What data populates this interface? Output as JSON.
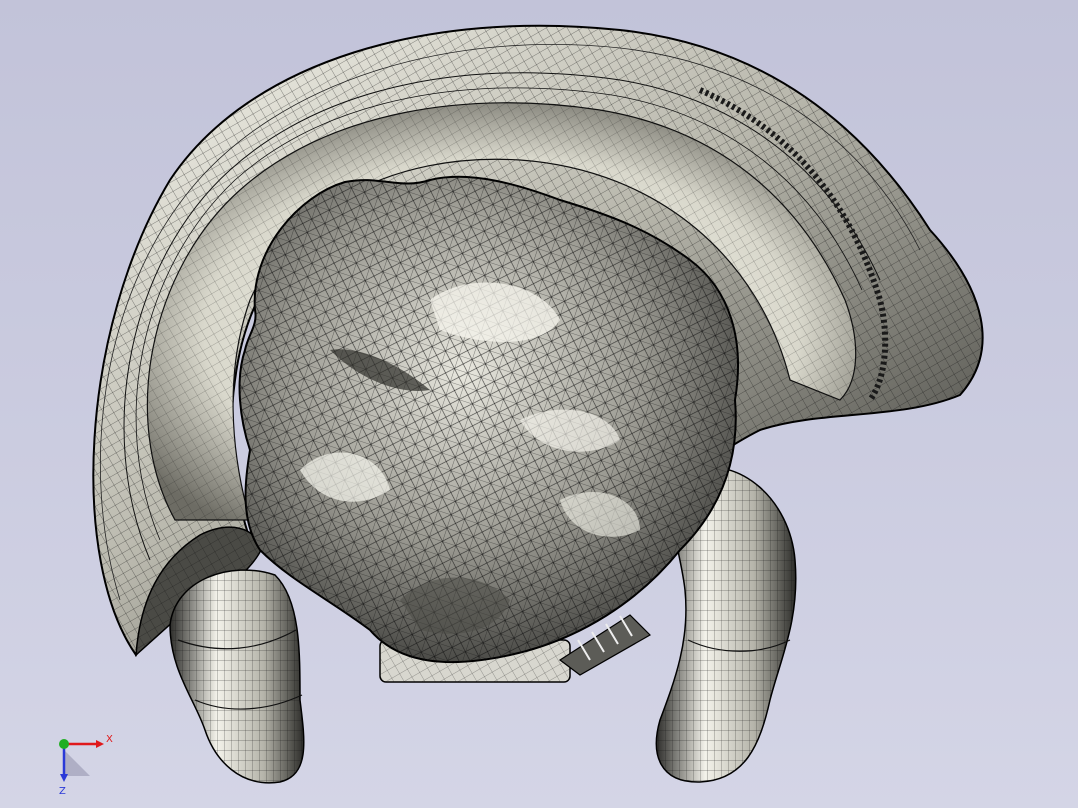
{
  "viewport": {
    "background": "#cbcce0",
    "model": {
      "name": "meshed-organic-model",
      "mesh_edge_color": "#0d0d0d",
      "surface_light": "#f4f3ea",
      "surface_dark": "#3a3a36"
    }
  },
  "triad": {
    "x_label": "X",
    "z_label": "Z",
    "colors": {
      "x": "#e0191b",
      "y": "#1fae22",
      "z": "#2a39d8"
    }
  }
}
